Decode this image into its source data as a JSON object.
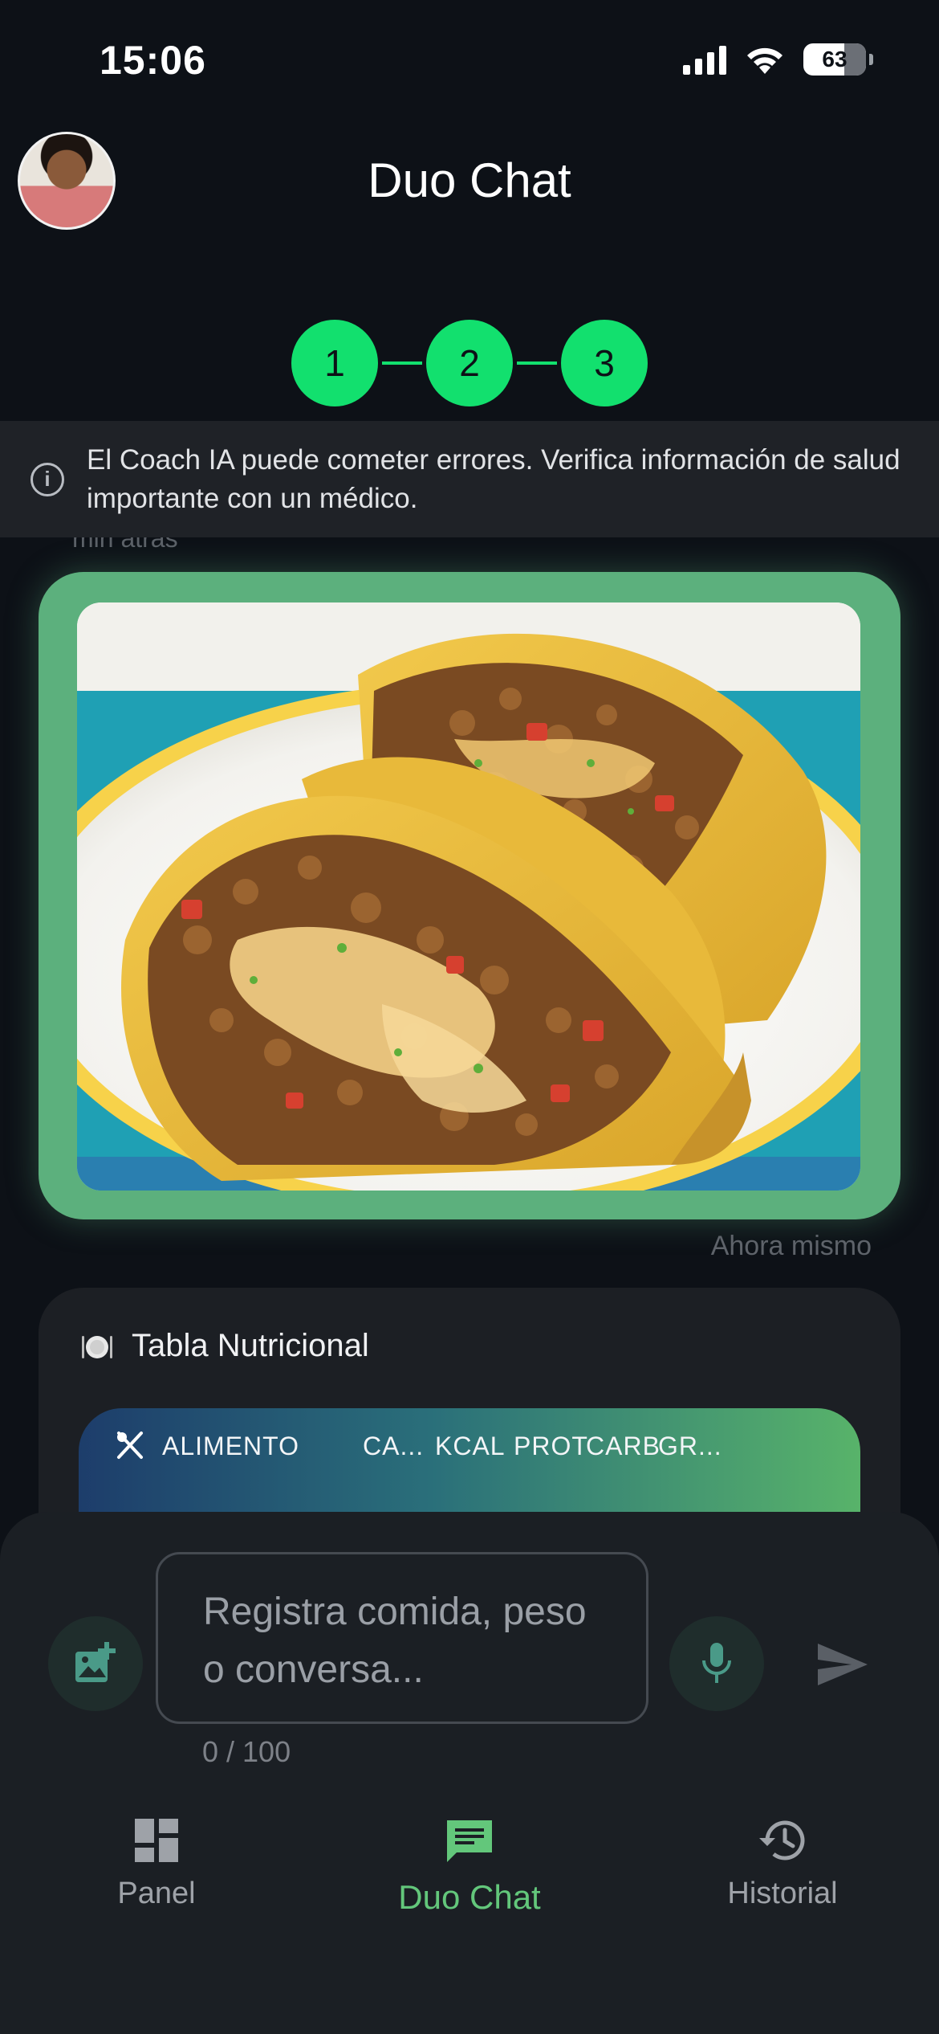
{
  "status_bar": {
    "time": "15:06",
    "battery": "63"
  },
  "header": {
    "title": "Duo Chat",
    "avatar": "user-avatar"
  },
  "stepper": {
    "steps": [
      "1",
      "2",
      "3"
    ]
  },
  "disclaimer": {
    "text": "El Coach IA puede cometer errores. Verifica información de salud importante con un médico."
  },
  "chat": {
    "previous_time": "min atrás",
    "image_message_time": "Ahora mismo",
    "nutrition": {
      "title": "Tabla Nutricional",
      "columns": [
        "ALIMENTO",
        "CA...",
        "KCAL",
        "PROT",
        "CARB",
        "GR..."
      ]
    }
  },
  "input": {
    "placeholder": "Registra comida, peso o conversa...",
    "value": "",
    "char_count": "0 / 100"
  },
  "nav": {
    "items": [
      {
        "label": "Panel",
        "icon": "dashboard-icon"
      },
      {
        "label": "Duo Chat",
        "icon": "chat-icon",
        "active": true
      },
      {
        "label": "Historial",
        "icon": "history-icon"
      }
    ]
  },
  "colors": {
    "accent": "#12e06e",
    "frame": "#5cb07d",
    "background": "#0d1117",
    "nav_active": "#63c77b"
  }
}
